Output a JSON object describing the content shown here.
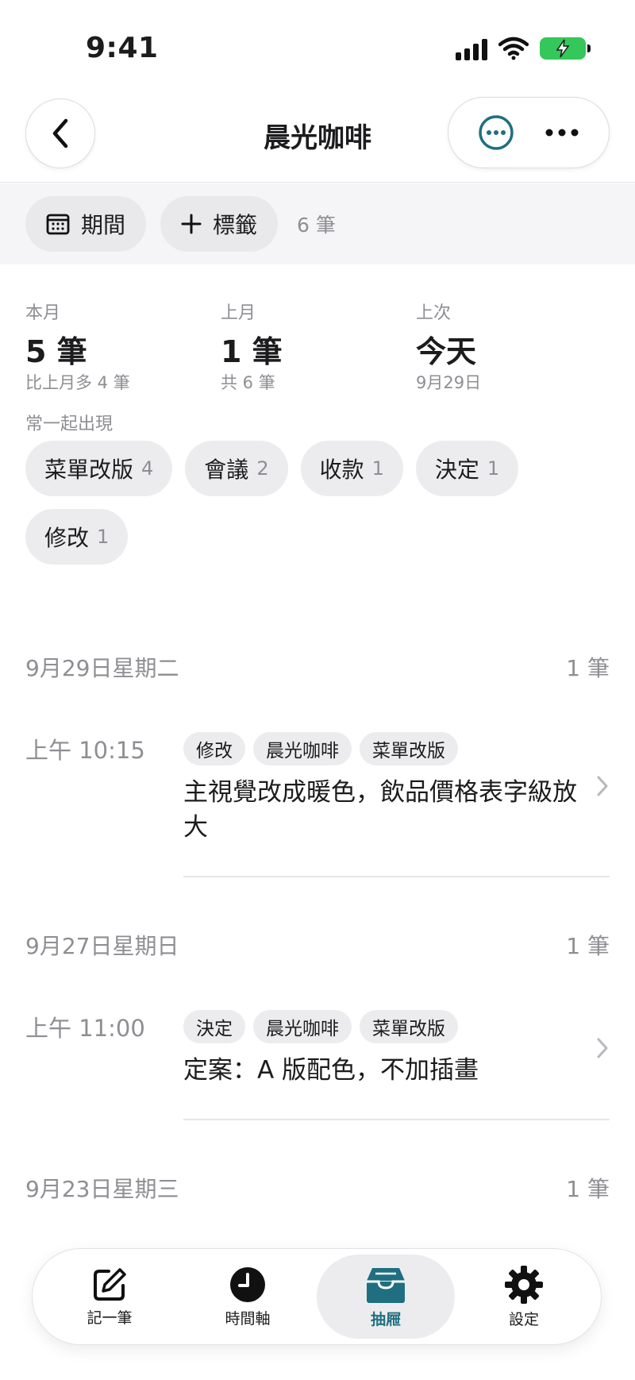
{
  "status_bar": {
    "time": "9:41"
  },
  "nav": {
    "title": "晨光咖啡"
  },
  "filter": {
    "period_label": "期間",
    "tag_label": "標籤",
    "count": "6 筆"
  },
  "stats": [
    {
      "label": "本月",
      "value": "5 筆",
      "sub": "比上月多 4 筆"
    },
    {
      "label": "上月",
      "value": "1 筆",
      "sub": "共 6 筆"
    },
    {
      "label": "上次",
      "value": "今天",
      "sub": "9月29日"
    }
  ],
  "co_occur": {
    "label": "常一起出現",
    "tags": [
      {
        "name": "菜單改版",
        "count": "4"
      },
      {
        "name": "會議",
        "count": "2"
      },
      {
        "name": "收款",
        "count": "1"
      },
      {
        "name": "決定",
        "count": "1"
      },
      {
        "name": "修改",
        "count": "1"
      }
    ]
  },
  "timeline": [
    {
      "date": "9月29日星期二",
      "count": "1 筆",
      "entries": [
        {
          "time": "上午 10:15",
          "tags": [
            "修改",
            "晨光咖啡",
            "菜單改版"
          ],
          "text": "主視覺改成暖色，飲品價格表字級放大"
        }
      ]
    },
    {
      "date": "9月27日星期日",
      "count": "1 筆",
      "entries": [
        {
          "time": "上午 11:00",
          "tags": [
            "決定",
            "晨光咖啡",
            "菜單改版"
          ],
          "text": "定案：A 版配色，不加插畫"
        }
      ]
    },
    {
      "date": "9月23日星期三",
      "count": "1 筆",
      "entries": []
    }
  ],
  "tab_bar": {
    "tabs": [
      {
        "label": "記一筆",
        "icon": "compose-icon"
      },
      {
        "label": "時間軸",
        "icon": "clock-icon"
      },
      {
        "label": "抽屜",
        "icon": "drawer-icon",
        "active": true
      },
      {
        "label": "設定",
        "icon": "gear-icon"
      }
    ]
  },
  "colors": {
    "accent": "#1f6f80",
    "battery": "#34c759",
    "muted": "#8e8e93"
  }
}
